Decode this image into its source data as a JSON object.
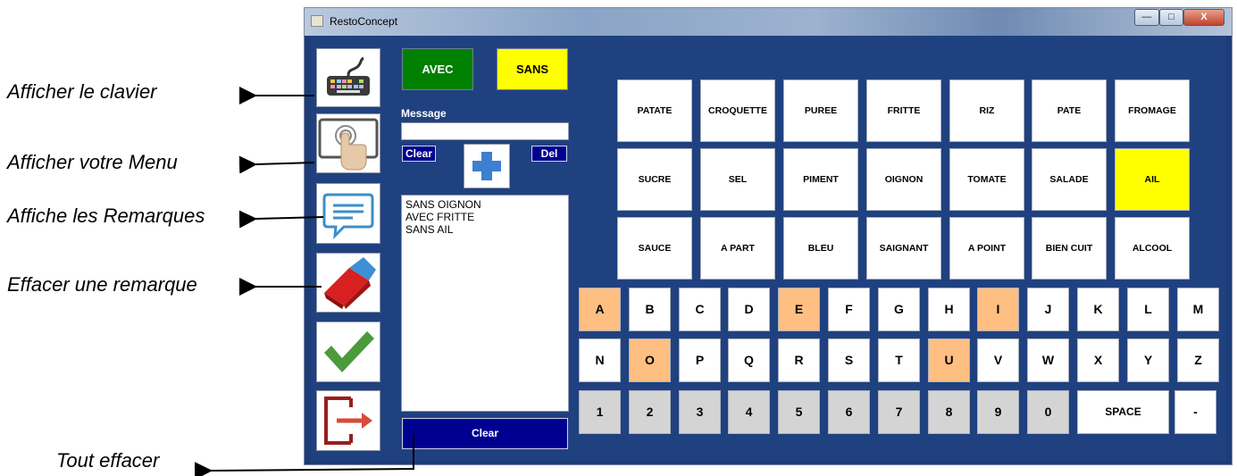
{
  "annotations": {
    "show_keyboard": "Afficher le clavier",
    "show_menu": "Afficher votre Menu",
    "show_remarks": "Affiche les Remarques",
    "erase_remark": "Effacer une remarque",
    "erase_all": "Tout effacer"
  },
  "window": {
    "title": "RestoConcept",
    "minimize": "—",
    "maximize": "□",
    "close": "X"
  },
  "sidebar": [
    {
      "name": "keyboard-icon"
    },
    {
      "name": "touch-menu-icon"
    },
    {
      "name": "comment-icon"
    },
    {
      "name": "eraser-icon"
    },
    {
      "name": "checkmark-icon"
    },
    {
      "name": "exit-icon"
    }
  ],
  "toggles": {
    "avec": "AVEC",
    "sans": "SANS",
    "avec_color": "#008000",
    "sans_color": "#ffff00"
  },
  "message": {
    "label": "Message",
    "value": "",
    "clear": "Clear",
    "del": "Del",
    "plus_icon": "plus-icon"
  },
  "remarks": [
    "SANS OIGNON",
    "AVEC FRITTE",
    "SANS AIL"
  ],
  "clear_all": "Clear",
  "ingredients": [
    [
      "PATATE",
      "CROQUETTE",
      "PUREE",
      "FRITTE",
      "RIZ",
      "PATE",
      "FROMAGE"
    ],
    [
      "SUCRE",
      "SEL",
      "PIMENT",
      "OIGNON",
      "TOMATE",
      "SALADE",
      "AIL"
    ],
    [
      "SAUCE",
      "A PART",
      "BLEU",
      "SAIGNANT",
      "A POINT",
      "BIEN CUIT",
      "ALCOOL"
    ]
  ],
  "selected_ingredient": "AIL",
  "keyboard": {
    "row1": [
      "A",
      "B",
      "C",
      "D",
      "E",
      "F",
      "G",
      "H",
      "I",
      "J",
      "K",
      "L",
      "M"
    ],
    "row2": [
      "N",
      "O",
      "P",
      "Q",
      "R",
      "S",
      "T",
      "U",
      "V",
      "W",
      "X",
      "Y",
      "Z"
    ],
    "row3": [
      "1",
      "2",
      "3",
      "4",
      "5",
      "6",
      "7",
      "8",
      "9",
      "0"
    ],
    "space": "SPACE",
    "dash": "-",
    "highlighted": [
      "A",
      "E",
      "I",
      "O",
      "U"
    ],
    "highlight_color": "#ffbe82",
    "digit_color": "#d4d4d4"
  }
}
